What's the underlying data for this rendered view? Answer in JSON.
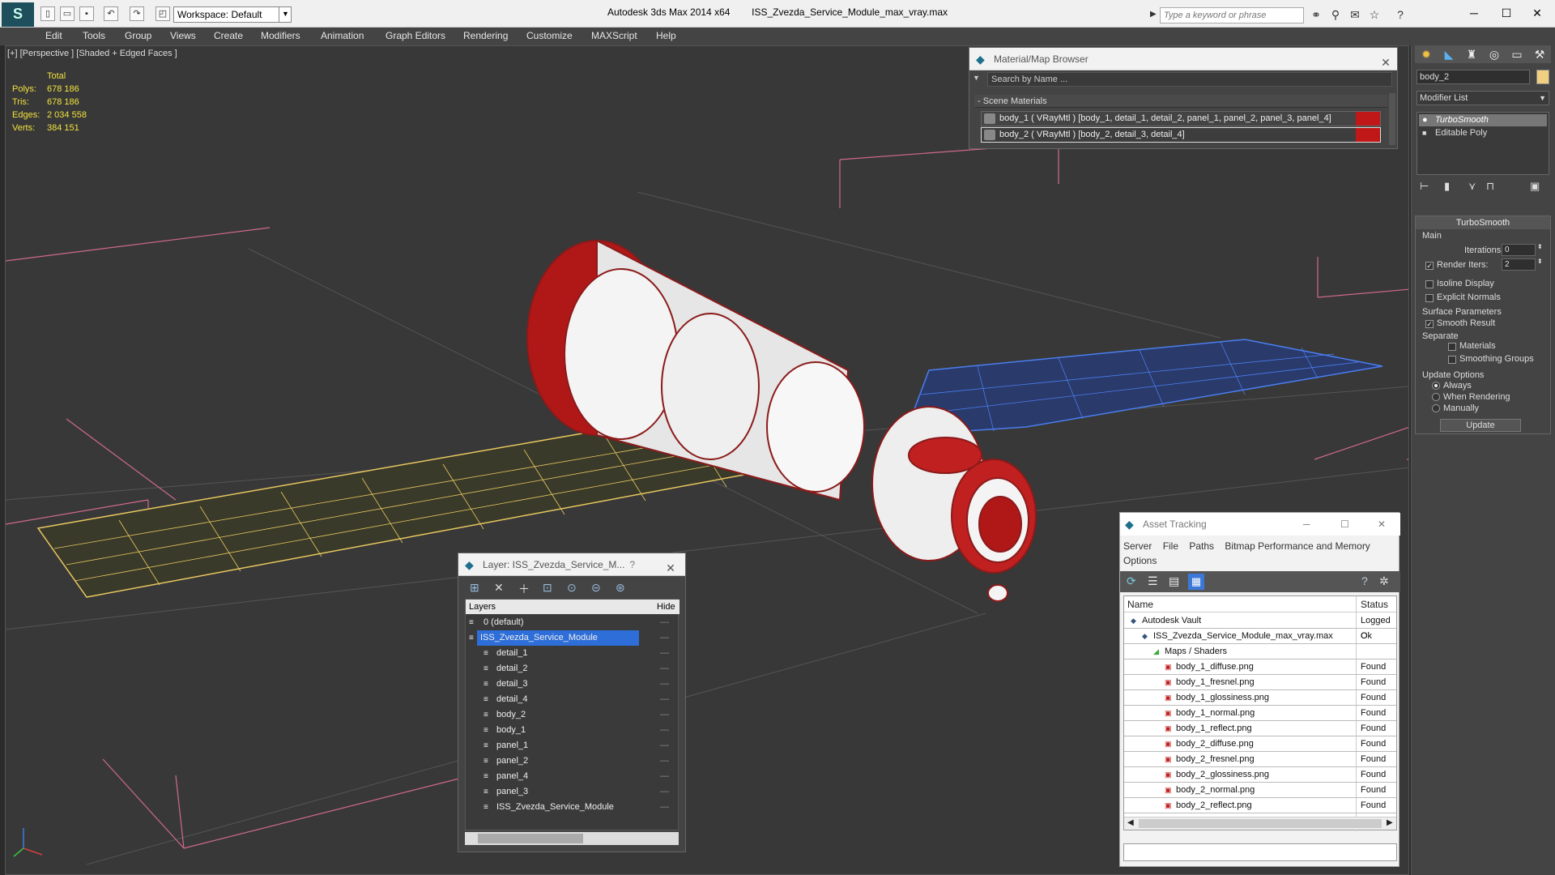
{
  "app": {
    "title": "Autodesk 3ds Max  2014 x64",
    "file": "ISS_Zvezda_Service_Module_max_vray.max",
    "logo_glyph": "S",
    "workspace": "Workspace: Default",
    "search_placeholder": "Type a keyword or phrase"
  },
  "menu": [
    "Edit",
    "Tools",
    "Group",
    "Views",
    "Create",
    "Modifiers",
    "Animation",
    "Graph Editors",
    "Rendering",
    "Customize",
    "MAXScript",
    "Help"
  ],
  "viewport": {
    "label": "[+] [Perspective ] [Shaded + Edged Faces ]",
    "stats": {
      "header": "Total",
      "rows": [
        {
          "label": "Polys:",
          "value": "678 186"
        },
        {
          "label": "Tris:",
          "value": "678 186"
        },
        {
          "label": "Edges:",
          "value": "2 034 558"
        },
        {
          "label": "Verts:",
          "value": "384 151"
        }
      ]
    },
    "colors": {
      "wire_body": "#8b1a1a",
      "panel_left": "#e8c860",
      "panel_right": "#3a6ed8",
      "grid": "#d06a8a"
    }
  },
  "material_browser": {
    "title": "Material/Map Browser",
    "search_placeholder": "Search by Name ...",
    "group": "- Scene Materials",
    "items": [
      "body_1  ( VRayMtl )  [body_1, detail_1, detail_2, panel_1, panel_2, panel_3, panel_4]",
      "body_2  ( VRayMtl )  [body_2, detail_3, detail_4]"
    ]
  },
  "layer_manager": {
    "title": "Layer: ISS_Zvezda_Service_M...",
    "help": "?",
    "col_layers": "Layers",
    "col_hide": "Hide",
    "rows": [
      {
        "name": "0 (default)",
        "indent": 1
      },
      {
        "name": "ISS_Zvezda_Service_Module",
        "indent": 1,
        "selected": true
      },
      {
        "name": "detail_1",
        "indent": 2
      },
      {
        "name": "detail_2",
        "indent": 2
      },
      {
        "name": "detail_3",
        "indent": 2
      },
      {
        "name": "detail_4",
        "indent": 2
      },
      {
        "name": "body_2",
        "indent": 2
      },
      {
        "name": "body_1",
        "indent": 2
      },
      {
        "name": "panel_1",
        "indent": 2
      },
      {
        "name": "panel_2",
        "indent": 2
      },
      {
        "name": "panel_4",
        "indent": 2
      },
      {
        "name": "panel_3",
        "indent": 2
      },
      {
        "name": "ISS_Zvezda_Service_Module",
        "indent": 2
      }
    ]
  },
  "asset_tracking": {
    "title": "Asset Tracking",
    "menu": [
      "Server",
      "File",
      "Paths",
      "Bitmap Performance and Memory",
      "Options"
    ],
    "col_name": "Name",
    "col_status": "Status",
    "rows": [
      {
        "name": "Autodesk Vault",
        "status": "Logged O",
        "indent": 1
      },
      {
        "name": "ISS_Zvezda_Service_Module_max_vray.max",
        "status": "Ok",
        "indent": 2
      },
      {
        "name": "Maps / Shaders",
        "status": "",
        "indent": 3
      },
      {
        "name": "body_1_diffuse.png",
        "status": "Found",
        "indent": 4
      },
      {
        "name": "body_1_fresnel.png",
        "status": "Found",
        "indent": 4
      },
      {
        "name": "body_1_glossiness.png",
        "status": "Found",
        "indent": 4
      },
      {
        "name": "body_1_normal.png",
        "status": "Found",
        "indent": 4
      },
      {
        "name": "body_1_reflect.png",
        "status": "Found",
        "indent": 4
      },
      {
        "name": "body_2_diffuse.png",
        "status": "Found",
        "indent": 4
      },
      {
        "name": "body_2_fresnel.png",
        "status": "Found",
        "indent": 4
      },
      {
        "name": "body_2_glossiness.png",
        "status": "Found",
        "indent": 4
      },
      {
        "name": "body_2_normal.png",
        "status": "Found",
        "indent": 4
      },
      {
        "name": "body_2_reflect.png",
        "status": "Found",
        "indent": 4
      }
    ]
  },
  "command_panel": {
    "object_name": "body_2",
    "modifier_list": "Modifier List",
    "stack": [
      "TurboSmooth",
      "Editable Poly"
    ],
    "rollout": "TurboSmooth",
    "main": "Main",
    "iterations_label": "Iterations:",
    "iterations": "0",
    "render_iters_label": "Render Iters:",
    "render_iters": "2",
    "isoline": "Isoline Display",
    "explicit_normals": "Explicit Normals",
    "surface_params": "Surface Parameters",
    "smooth_result": "Smooth Result",
    "separate": "Separate",
    "materials": "Materials",
    "smoothing_groups": "Smoothing Groups",
    "update_options": "Update Options",
    "always": "Always",
    "when_rendering": "When Rendering",
    "manually": "Manually",
    "update_button": "Update"
  }
}
